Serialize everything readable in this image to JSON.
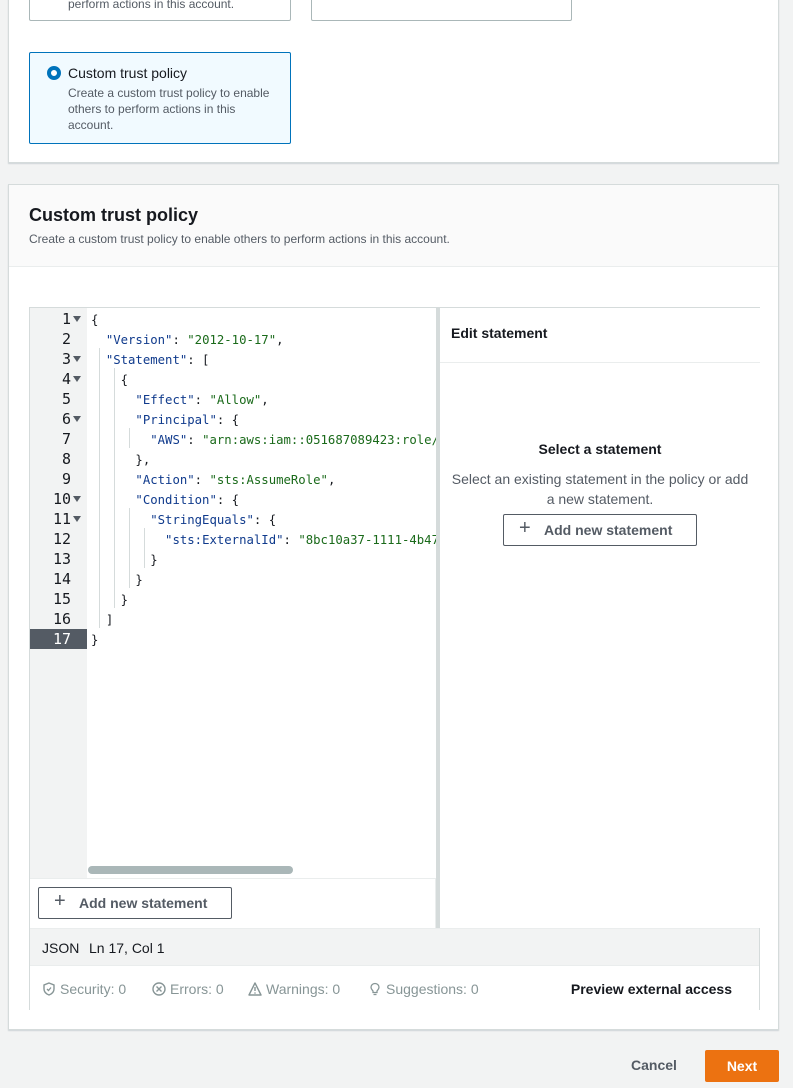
{
  "top_options": {
    "tile_a_desc": "perform actions in this account.",
    "selected": {
      "title": "Custom trust policy",
      "desc": "Create a custom trust policy to enable others to perform actions in this account."
    }
  },
  "section": {
    "title": "Custom trust policy",
    "desc": "Create a custom trust policy to enable others to perform actions in this account."
  },
  "editor": {
    "line_numbers": [
      "1",
      "2",
      "3",
      "4",
      "5",
      "6",
      "7",
      "8",
      "9",
      "10",
      "11",
      "12",
      "13",
      "14",
      "15",
      "16",
      "17"
    ],
    "active_line": "17",
    "code": {
      "l1": "{",
      "l2_key": "\"Version\"",
      "l2_val": "\"2012-10-17\"",
      "l3_key": "\"Statement\"",
      "l3_rest": ": [",
      "l4": "{",
      "l5_key": "\"Effect\"",
      "l5_val": "\"Allow\"",
      "l6_key": "\"Principal\"",
      "l6_rest": ": {",
      "l7_key": "\"AWS\"",
      "l7_val": "\"arn:aws:iam::051687089423:role/c",
      "l8": "},",
      "l9_key": "\"Action\"",
      "l9_val": "\"sts:AssumeRole\"",
      "l10_key": "\"Condition\"",
      "l10_rest": ": {",
      "l11_key": "\"StringEquals\"",
      "l11_rest": ": {",
      "l12_key": "\"sts:ExternalId\"",
      "l12_val": "\"8bc10a37-1111-4b47-",
      "l13": "}",
      "l14": "}",
      "l15": "}",
      "l16": "]",
      "l17": "}"
    },
    "add_statement_label": "Add new statement",
    "side": {
      "header": "Edit statement",
      "select_title": "Select a statement",
      "select_desc": "Select an existing statement in the policy or add a new statement.",
      "add_label": "Add new statement"
    },
    "status": {
      "language": "JSON",
      "cursor": "Ln 17, Col 1"
    },
    "validation": {
      "security": "Security: 0",
      "errors": "Errors: 0",
      "warnings": "Warnings: 0",
      "suggestions": "Suggestions: 0",
      "preview": "Preview external access"
    }
  },
  "footer": {
    "cancel": "Cancel",
    "next": "Next"
  },
  "colors": {
    "accent": "#0073bb",
    "primary_button": "#ec7211",
    "json_key": "#0f3a8c",
    "json_string": "#1a6a1a"
  },
  "icons": [
    "plus-icon",
    "shield-icon",
    "x-circle-icon",
    "warning-icon",
    "lightbulb-icon",
    "fold-arrow-icon"
  ]
}
